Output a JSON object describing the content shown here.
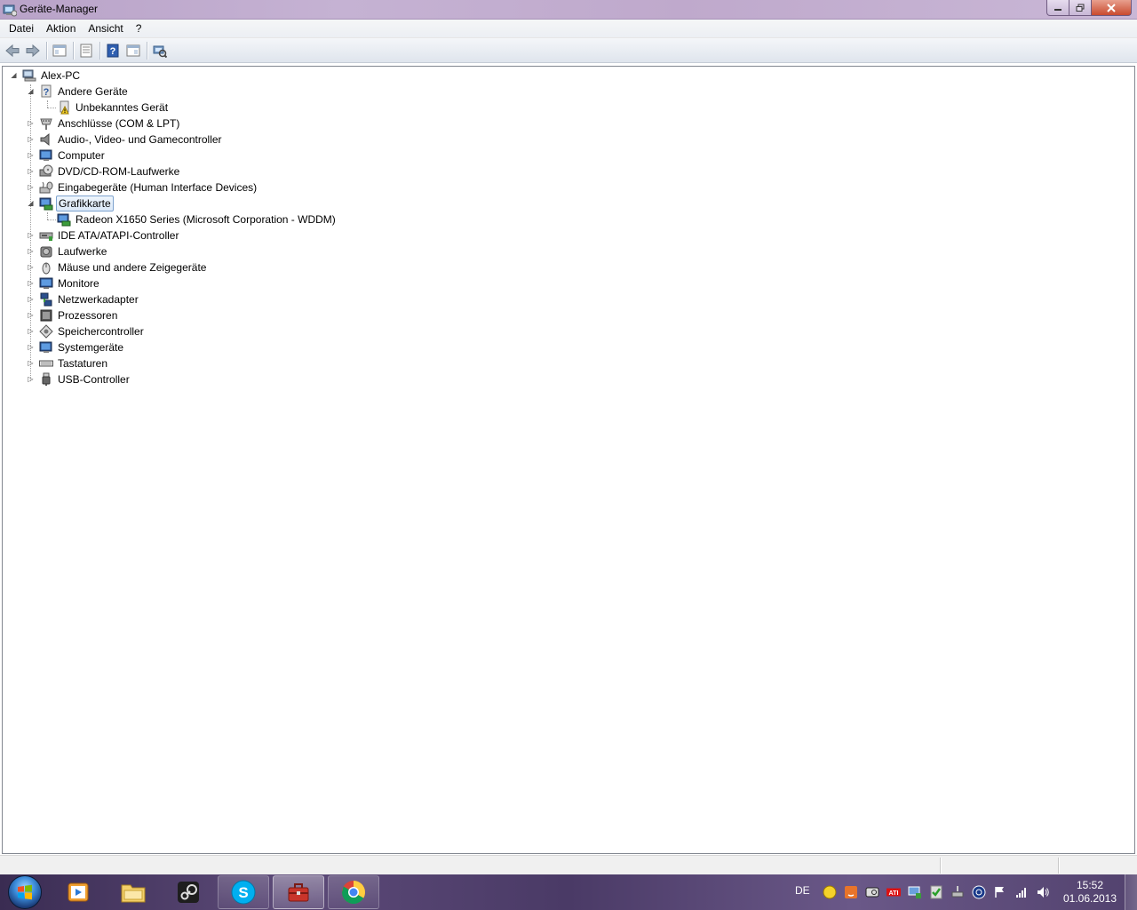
{
  "window": {
    "title": "Geräte-Manager",
    "controls": {
      "minimize": "minimize",
      "maximize": "restore",
      "close": "close"
    }
  },
  "menu": {
    "items": [
      "Datei",
      "Aktion",
      "Ansicht",
      "?"
    ]
  },
  "toolbar": {
    "buttons": [
      "back-arrow-icon",
      "forward-arrow-icon",
      "console-tree-icon",
      "properties-icon",
      "help-icon",
      "action-pane-icon",
      "scan-hardware-icon"
    ]
  },
  "tree": {
    "root": "Alex-PC",
    "nodes": [
      {
        "label": "Andere Geräte",
        "icon": "unknown-device-icon",
        "expanded": true
      },
      {
        "label": "Unbekanntes Gerät",
        "icon": "warning-device-icon",
        "child": true
      },
      {
        "label": "Anschlüsse (COM & LPT)",
        "icon": "port-icon"
      },
      {
        "label": "Audio-, Video- und Gamecontroller",
        "icon": "speaker-icon"
      },
      {
        "label": "Computer",
        "icon": "computer-icon"
      },
      {
        "label": "DVD/CD-ROM-Laufwerke",
        "icon": "dvd-drive-icon"
      },
      {
        "label": "Eingabegeräte (Human Interface Devices)",
        "icon": "hid-icon"
      },
      {
        "label": "Grafikkarte",
        "icon": "display-adapter-icon",
        "expanded": true,
        "selected": true
      },
      {
        "label": "Radeon X1650 Series (Microsoft Corporation - WDDM)",
        "icon": "display-adapter-icon",
        "child": true
      },
      {
        "label": "IDE ATA/ATAPI-Controller",
        "icon": "ide-controller-icon"
      },
      {
        "label": "Laufwerke",
        "icon": "disk-drive-icon"
      },
      {
        "label": "Mäuse und andere Zeigegeräte",
        "icon": "mouse-icon"
      },
      {
        "label": "Monitore",
        "icon": "monitor-icon"
      },
      {
        "label": "Netzwerkadapter",
        "icon": "network-adapter-icon"
      },
      {
        "label": "Prozessoren",
        "icon": "processor-icon"
      },
      {
        "label": "Speichercontroller",
        "icon": "storage-controller-icon"
      },
      {
        "label": "Systemgeräte",
        "icon": "system-device-icon"
      },
      {
        "label": "Tastaturen",
        "icon": "keyboard-icon"
      },
      {
        "label": "USB-Controller",
        "icon": "usb-icon"
      }
    ]
  },
  "taskbar": {
    "apps": [
      "media-player-icon",
      "explorer-icon",
      "steam-icon",
      "skype-icon",
      "device-manager-icon",
      "chrome-icon"
    ],
    "language": "DE",
    "clock": {
      "time": "15:52",
      "date": "01.06.2013"
    }
  },
  "colors": {
    "title_bar": "#c5b2d3",
    "selection": "#dbe9f8",
    "selection_border": "#7da2ce",
    "taskbar": "#4a3a66"
  }
}
